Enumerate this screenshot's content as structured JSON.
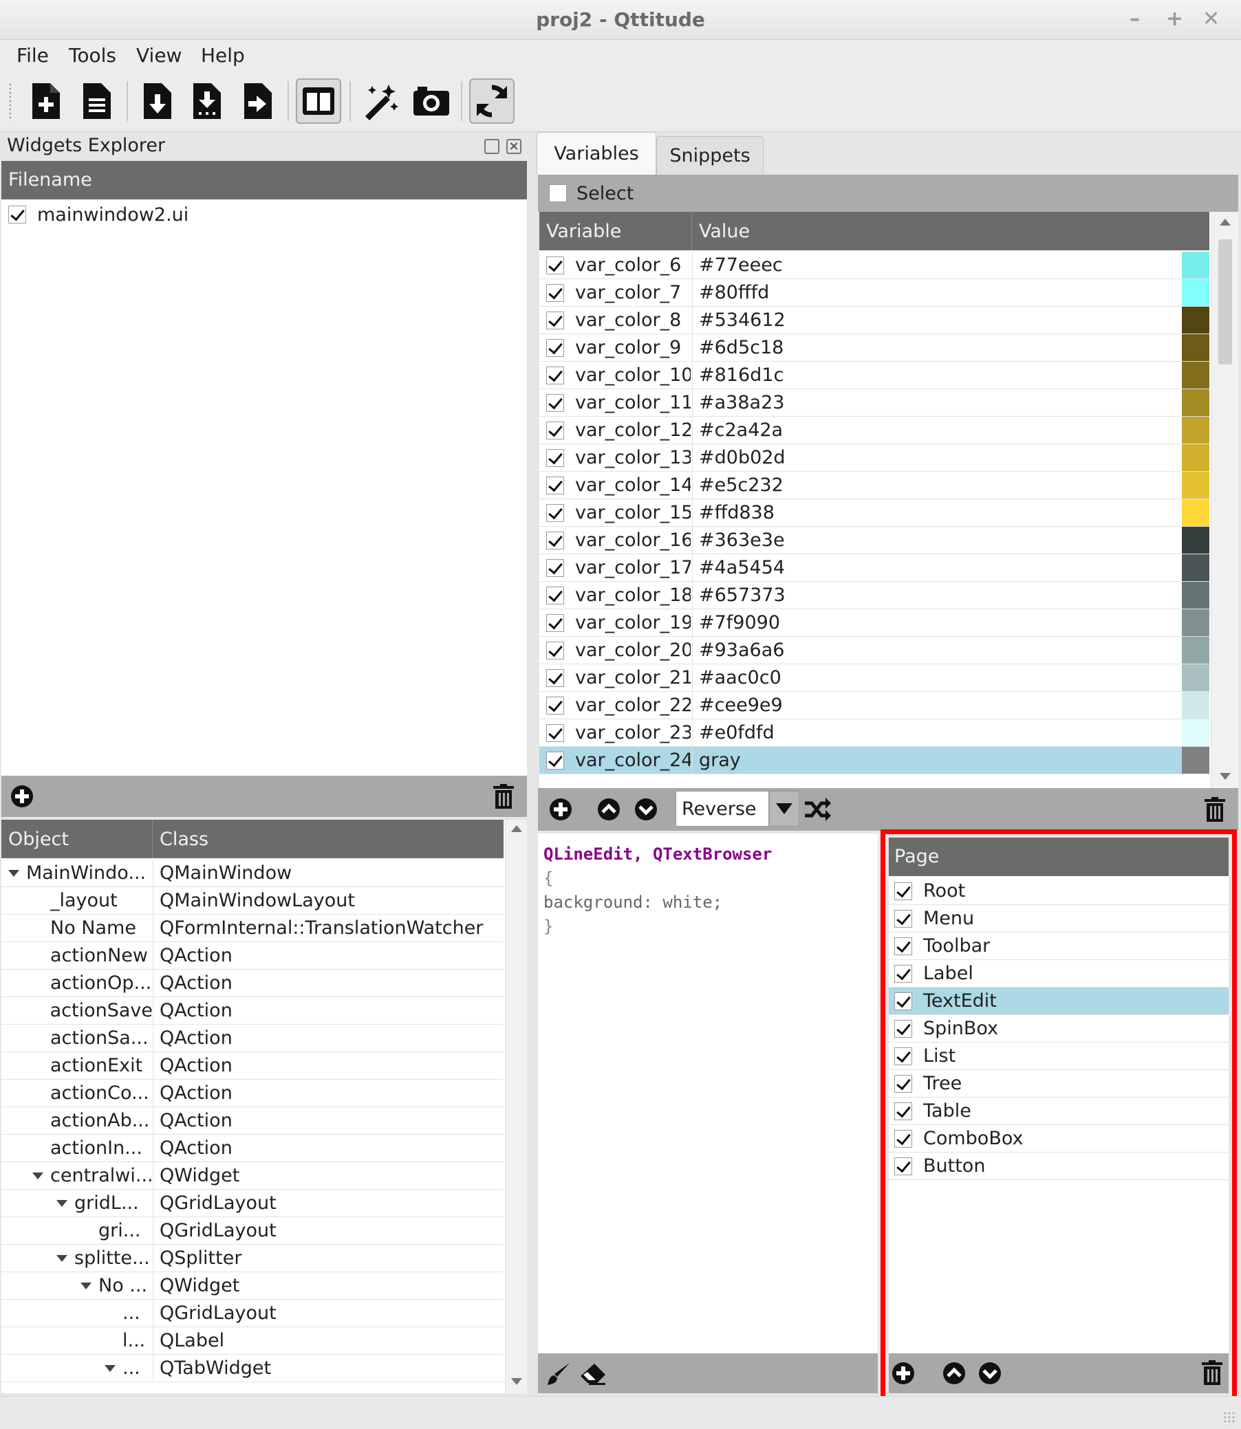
{
  "window": {
    "title": "proj2 - Qttitude",
    "minimize": "–",
    "maximize": "+",
    "close": "✕"
  },
  "menu": [
    "File",
    "Tools",
    "View",
    "Help"
  ],
  "widgets_explorer": {
    "title": "Widgets Explorer",
    "filename_header": "Filename",
    "files": [
      {
        "name": "mainwindow2.ui",
        "checked": true
      }
    ]
  },
  "object_tree": {
    "headers": [
      "Object",
      "Class"
    ],
    "rows": [
      {
        "object": "MainWindo...",
        "class": "QMainWindow",
        "indent": 0,
        "arrow": true
      },
      {
        "object": "_layout",
        "class": "QMainWindowLayout",
        "indent": 1,
        "arrow": false
      },
      {
        "object": "No Name",
        "class": "QFormInternal::TranslationWatcher",
        "indent": 1,
        "arrow": false
      },
      {
        "object": "actionNew",
        "class": "QAction",
        "indent": 1,
        "arrow": false
      },
      {
        "object": "actionOp...",
        "class": "QAction",
        "indent": 1,
        "arrow": false
      },
      {
        "object": "actionSave",
        "class": "QAction",
        "indent": 1,
        "arrow": false
      },
      {
        "object": "actionSa...",
        "class": "QAction",
        "indent": 1,
        "arrow": false
      },
      {
        "object": "actionExit",
        "class": "QAction",
        "indent": 1,
        "arrow": false
      },
      {
        "object": "actionCo...",
        "class": "QAction",
        "indent": 1,
        "arrow": false
      },
      {
        "object": "actionAb...",
        "class": "QAction",
        "indent": 1,
        "arrow": false
      },
      {
        "object": "actionIn...",
        "class": "QAction",
        "indent": 1,
        "arrow": false
      },
      {
        "object": "centralwi...",
        "class": "QWidget",
        "indent": 1,
        "arrow": true
      },
      {
        "object": "gridL...",
        "class": "QGridLayout",
        "indent": 2,
        "arrow": true
      },
      {
        "object": "gri...",
        "class": "QGridLayout",
        "indent": 3,
        "arrow": false
      },
      {
        "object": "splitte...",
        "class": "QSplitter",
        "indent": 2,
        "arrow": true
      },
      {
        "object": "No ...",
        "class": "QWidget",
        "indent": 3,
        "arrow": true
      },
      {
        "object": "...",
        "class": "QGridLayout",
        "indent": 4,
        "arrow": false
      },
      {
        "object": "l...",
        "class": "QLabel",
        "indent": 4,
        "arrow": false
      },
      {
        "object": "...",
        "class": "QTabWidget",
        "indent": 4,
        "arrow": true
      }
    ]
  },
  "tabs": [
    "Variables",
    "Snippets"
  ],
  "variables": {
    "select_label": "Select",
    "headers": [
      "Variable",
      "Value"
    ],
    "rows": [
      {
        "name": "var_color_6",
        "value": "#77eeec",
        "swatch": "#77eeec"
      },
      {
        "name": "var_color_7",
        "value": "#80fffd",
        "swatch": "#80fffd"
      },
      {
        "name": "var_color_8",
        "value": "#534612",
        "swatch": "#534612"
      },
      {
        "name": "var_color_9",
        "value": "#6d5c18",
        "swatch": "#6d5c18"
      },
      {
        "name": "var_color_10",
        "value": "#816d1c",
        "swatch": "#816d1c"
      },
      {
        "name": "var_color_11",
        "value": "#a38a23",
        "swatch": "#a38a23"
      },
      {
        "name": "var_color_12",
        "value": "#c2a42a",
        "swatch": "#c2a42a"
      },
      {
        "name": "var_color_13",
        "value": "#d0b02d",
        "swatch": "#d0b02d"
      },
      {
        "name": "var_color_14",
        "value": "#e5c232",
        "swatch": "#e5c232"
      },
      {
        "name": "var_color_15",
        "value": "#ffd838",
        "swatch": "#ffd838"
      },
      {
        "name": "var_color_16",
        "value": "#363e3e",
        "swatch": "#363e3e"
      },
      {
        "name": "var_color_17",
        "value": "#4a5454",
        "swatch": "#4a5454"
      },
      {
        "name": "var_color_18",
        "value": "#657373",
        "swatch": "#657373"
      },
      {
        "name": "var_color_19",
        "value": "#7f9090",
        "swatch": "#7f9090"
      },
      {
        "name": "var_color_20",
        "value": "#93a6a6",
        "swatch": "#93a6a6"
      },
      {
        "name": "var_color_21",
        "value": "#aac0c0",
        "swatch": "#aac0c0"
      },
      {
        "name": "var_color_22",
        "value": "#cee9e9",
        "swatch": "#cee9e9"
      },
      {
        "name": "var_color_23",
        "value": "#e0fdfd",
        "swatch": "#e0fdfd"
      },
      {
        "name": "var_color_24",
        "value": "gray",
        "swatch": "#808080",
        "selected": true
      }
    ],
    "combo_value": "Reverse"
  },
  "editor": {
    "lines": [
      {
        "text": "QLineEdit, QTextBrowser",
        "kind": "selector"
      },
      {
        "text": "{",
        "kind": "brace"
      },
      {
        "text": "background: white;",
        "kind": "prop"
      },
      {
        "text": "}",
        "kind": "brace"
      }
    ]
  },
  "pages": {
    "header": "Page",
    "items": [
      {
        "label": "Root"
      },
      {
        "label": "Menu"
      },
      {
        "label": "Toolbar"
      },
      {
        "label": "Label"
      },
      {
        "label": "TextEdit",
        "selected": true
      },
      {
        "label": "SpinBox"
      },
      {
        "label": "List"
      },
      {
        "label": "Tree"
      },
      {
        "label": "Table"
      },
      {
        "label": "ComboBox"
      },
      {
        "label": "Button"
      }
    ]
  },
  "colors": {
    "header_bg": "#6b6b6b",
    "selection": "#add8e6",
    "highlight_frame": "#ff0000",
    "selector_text": "#8b008b"
  }
}
